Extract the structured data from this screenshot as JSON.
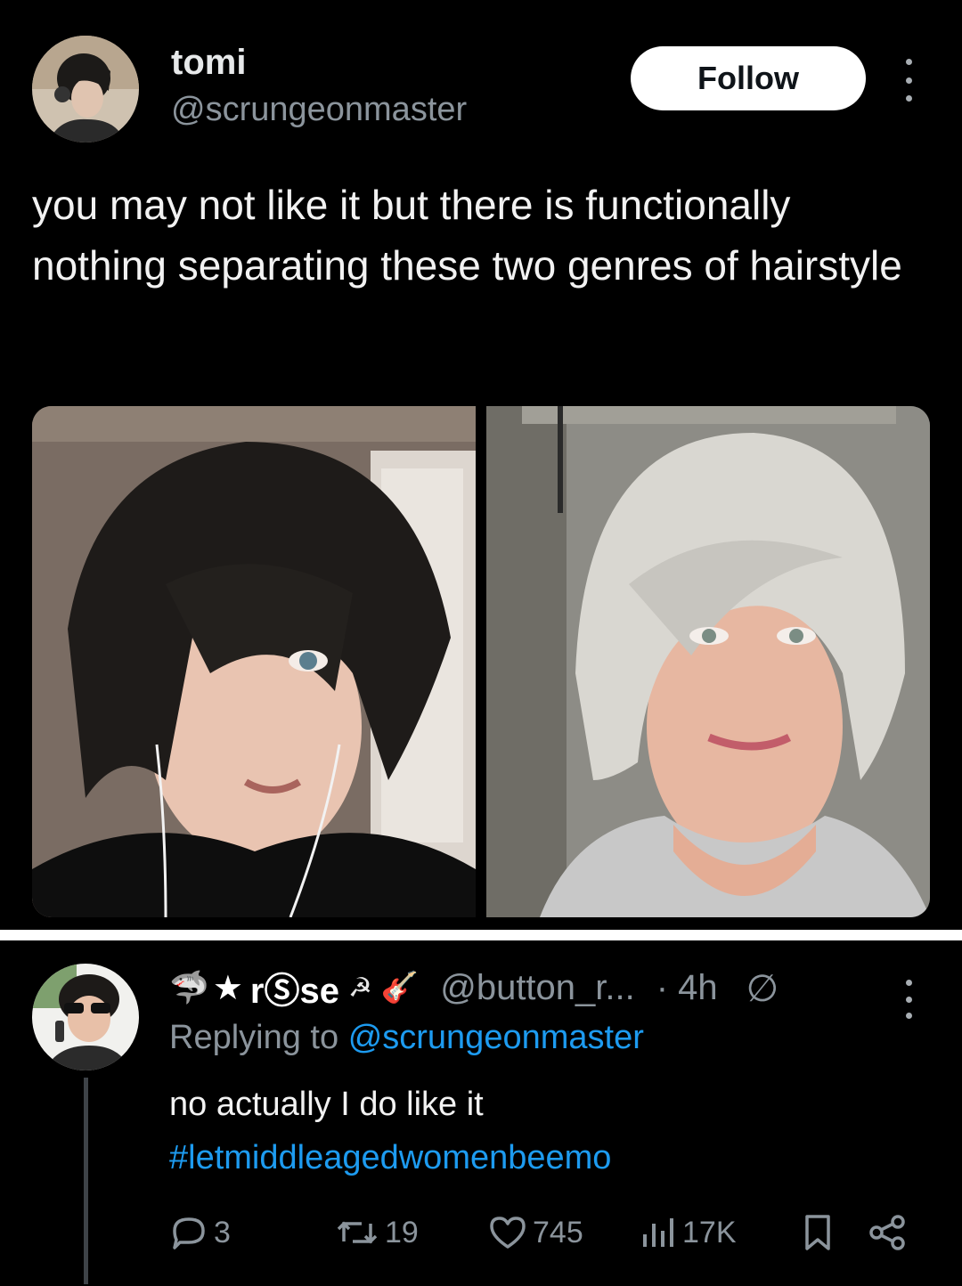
{
  "tweet": {
    "author_name": "tomi",
    "author_handle": "@scrungeonmaster",
    "follow_label": "Follow",
    "text": "you may not like it but there is functionally nothing separating these two genres of hairstyle",
    "images": [
      {
        "alt": "young man with black emo hairstyle"
      },
      {
        "alt": "middle-aged woman with silver layered bob"
      }
    ]
  },
  "reply": {
    "name_prefix_icons": [
      "shark-icon",
      "star-icon"
    ],
    "author_name": "rⓈse",
    "name_suffix_icons": [
      "hammer-sickle-icon",
      "guitar-icon"
    ],
    "author_handle": "@button_r...",
    "time": "· 4h",
    "edit_icon": "edit-history-icon",
    "replying_prefix": "Replying to",
    "replying_mention": "@scrungeonmaster",
    "text": "no actually I do like it",
    "hashtag": "#letmiddleagedwomenbeemo",
    "actions": {
      "replies": "3",
      "reposts": "19",
      "likes": "745",
      "views": "17K"
    }
  },
  "colors": {
    "background": "#000000",
    "text": "#e7e9ea",
    "muted": "#8b949c",
    "link": "#1d9bf0",
    "follow_bg": "#ffffff"
  }
}
